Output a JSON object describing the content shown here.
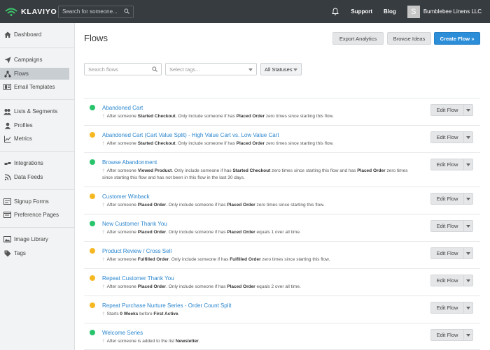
{
  "topbar": {
    "logo_text": "KLAVIYO",
    "search_placeholder": "Search for someone...",
    "links": [
      "Support",
      "Blog"
    ],
    "account_initial": "S",
    "account_name": "Bumblebee Linens LLC"
  },
  "sidebar": {
    "items": [
      {
        "label": "Dashboard",
        "icon": "dashboard-icon"
      },
      {
        "label": "Campaigns",
        "icon": "paper-plane-icon"
      },
      {
        "label": "Flows",
        "icon": "flows-icon"
      },
      {
        "label": "Email Templates",
        "icon": "email-templates-icon"
      },
      {
        "label": "Lists & Segments",
        "icon": "users-icon"
      },
      {
        "label": "Profiles",
        "icon": "profile-icon"
      },
      {
        "label": "Metrics",
        "icon": "metrics-icon"
      },
      {
        "label": "Integrations",
        "icon": "integrations-icon"
      },
      {
        "label": "Data Feeds",
        "icon": "data-feeds-icon"
      },
      {
        "label": "Signup Forms",
        "icon": "signup-forms-icon"
      },
      {
        "label": "Preference Pages",
        "icon": "preference-pages-icon"
      },
      {
        "label": "Image Library",
        "icon": "image-icon"
      },
      {
        "label": "Tags",
        "icon": "tag-icon"
      }
    ],
    "active": "Flows"
  },
  "main": {
    "title": "Flows",
    "buttons": {
      "export": "Export Analytics",
      "browse": "Browse Ideas",
      "create": "Create Flow »"
    },
    "filters": {
      "search_placeholder": "Search flows",
      "tags_placeholder": "Select tags...",
      "status_value": "All Statuses"
    },
    "edit_label": "Edit Flow",
    "colors": {
      "live": "#27c46b",
      "manual": "#f5b822",
      "link": "#2a86cf",
      "accent": "#2c8ed9"
    }
  },
  "flows": [
    {
      "name": "Abandoned Cart",
      "status": "live",
      "desc": [
        [
          "After someone ",
          ""
        ],
        [
          "Started Checkout",
          "b"
        ],
        [
          ". Only include someone if has ",
          ""
        ],
        [
          "Placed Order",
          "b"
        ],
        [
          " zero times since starting this flow.",
          ""
        ]
      ]
    },
    {
      "name": "Abandoned Cart (Cart Value Split) - High Value Cart vs. Low Value Cart",
      "status": "manual",
      "desc": [
        [
          "After someone ",
          ""
        ],
        [
          "Started Checkout",
          "b"
        ],
        [
          ". Only include someone if has ",
          ""
        ],
        [
          "Placed Order",
          "b"
        ],
        [
          " zero times since starting this flow.",
          ""
        ]
      ]
    },
    {
      "name": "Browse Abandonment",
      "status": "live",
      "desc": [
        [
          "After someone ",
          ""
        ],
        [
          "Viewed Product",
          "b"
        ],
        [
          ". Only include someone if has ",
          ""
        ],
        [
          "Started Checkout",
          "b"
        ],
        [
          " zero times since starting this flow and has ",
          ""
        ],
        [
          "Placed Order",
          "b"
        ],
        [
          " zero times since starting this flow and has not been in this flow in the last 30 days.",
          ""
        ]
      ]
    },
    {
      "name": "Customer Winback",
      "status": "manual",
      "desc": [
        [
          "After someone ",
          ""
        ],
        [
          "Placed Order",
          "b"
        ],
        [
          ". Only include someone if has ",
          ""
        ],
        [
          "Placed Order",
          "b"
        ],
        [
          " zero times since starting this flow.",
          ""
        ]
      ]
    },
    {
      "name": "New Customer Thank You",
      "status": "live",
      "desc": [
        [
          "After someone ",
          ""
        ],
        [
          "Placed Order",
          "b"
        ],
        [
          ". Only include someone if has ",
          ""
        ],
        [
          "Placed Order",
          "b"
        ],
        [
          " equals 1 over all time.",
          ""
        ]
      ]
    },
    {
      "name": "Product Review / Cross Sell",
      "status": "manual",
      "desc": [
        [
          "After someone ",
          ""
        ],
        [
          "Fulfilled Order",
          "b"
        ],
        [
          ". Only include someone if has ",
          ""
        ],
        [
          "Fulfilled Order",
          "b"
        ],
        [
          " zero times since starting this flow.",
          ""
        ]
      ]
    },
    {
      "name": "Repeat Customer Thank You",
      "status": "manual",
      "desc": [
        [
          "After someone ",
          ""
        ],
        [
          "Placed Order",
          "b"
        ],
        [
          ". Only include someone if has ",
          ""
        ],
        [
          "Placed Order",
          "b"
        ],
        [
          " equals 2 over all time.",
          ""
        ]
      ]
    },
    {
      "name": "Repeat Purchase Nurture Series - Order Count Split",
      "status": "manual",
      "desc": [
        [
          "Starts ",
          ""
        ],
        [
          "0 Weeks",
          "b"
        ],
        [
          " before ",
          ""
        ],
        [
          "First Active",
          "b"
        ],
        [
          ".",
          ""
        ]
      ]
    },
    {
      "name": "Welcome Series",
      "status": "live",
      "desc": [
        [
          "After someone is added to the list ",
          ""
        ],
        [
          "Newsletter",
          "b"
        ],
        [
          ".",
          ""
        ]
      ]
    }
  ]
}
